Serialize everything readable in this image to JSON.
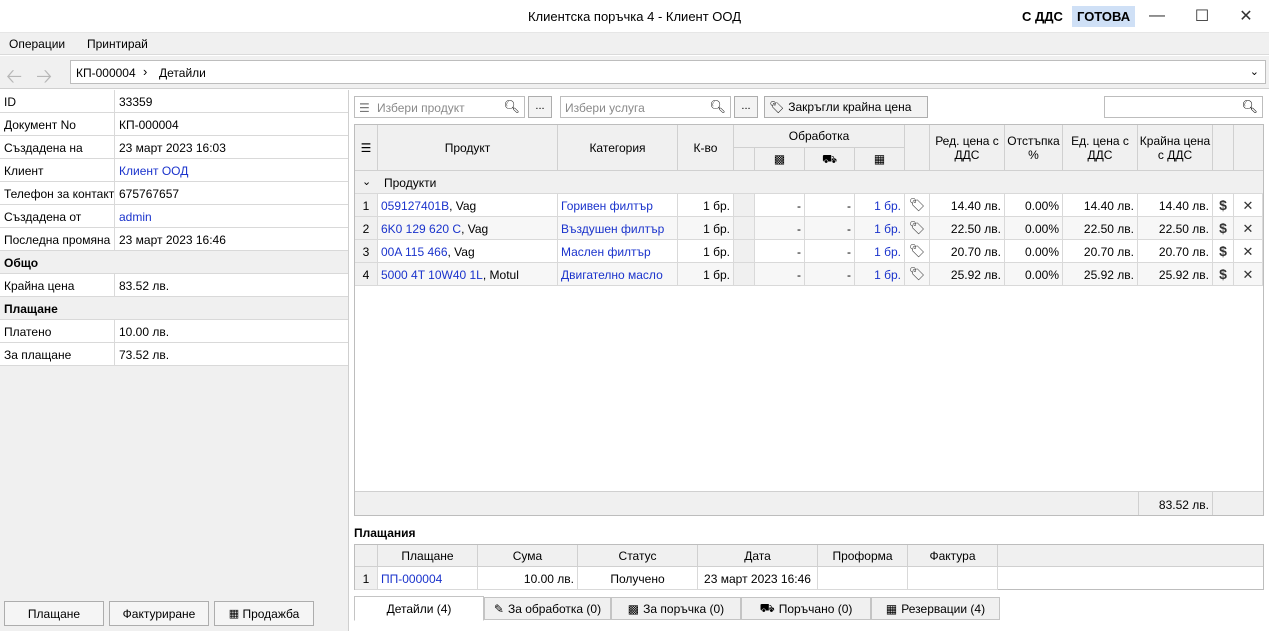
{
  "window": {
    "title": "Клиентска поръчка 4 - Клиент ООД",
    "vat_label": "С ДДС",
    "status": "ГОТОВА"
  },
  "menu": [
    "Операции",
    "Принтирай"
  ],
  "breadcrumb": {
    "doc": "КП-000004",
    "section": "Детайли"
  },
  "details": [
    {
      "key": "ID",
      "value": "33359"
    },
    {
      "key": "Документ No",
      "value": "КП-000004"
    },
    {
      "key": "Създадена на",
      "value": "23 март 2023 16:03"
    },
    {
      "key": "Клиент",
      "value": "Клиент ООД",
      "link": true
    },
    {
      "key": "Телефон за контакт",
      "value": "675767657"
    },
    {
      "key": "Създадена от",
      "value": "admin",
      "link": true
    },
    {
      "key": "Последна промяна",
      "value": "23 март 2023 16:46"
    }
  ],
  "total_group": "Общо",
  "total_row": {
    "key": "Крайна цена",
    "value": "83.52 лв."
  },
  "payment_group": "Плащане",
  "payment_rows": [
    {
      "key": "Платено",
      "value": "10.00 лв."
    },
    {
      "key": "За плащане",
      "value": "73.52 лв."
    }
  ],
  "left_buttons": {
    "pay": "Плащане",
    "invoice": "Фактуриране",
    "sale": "Продажба"
  },
  "toolbar": {
    "product_placeholder": "Избери продукт",
    "service_placeholder": "Избери услуга",
    "dots": "...",
    "round_label": "Закръгли крайна цена"
  },
  "grid": {
    "headers": {
      "product": "Продукт",
      "category": "Категория",
      "qty": "К-во",
      "processing": "Обработка",
      "unit_price_vat": "Ред. цена с ДДС",
      "discount": "Отстъпка %",
      "unit_price": "Ед. цена с ДДС",
      "final_price": "Крайна цена с ДДС"
    },
    "group_label": "Продукти",
    "rows": [
      {
        "n": "1",
        "code": "059127401B",
        "brand": ", Vag",
        "category": "Горивен филтър",
        "qty": "1 бр.",
        "p1": "-",
        "p2": "-",
        "p3": "1 бр.",
        "price": "14.40 лв.",
        "disc": "0.00%",
        "unit": "14.40 лв.",
        "final": "14.40 лв."
      },
      {
        "n": "2",
        "code": "6K0 129 620 C",
        "brand": ", Vag",
        "category": "Въздушен филтър",
        "qty": "1 бр.",
        "p1": "-",
        "p2": "-",
        "p3": "1 бр.",
        "price": "22.50 лв.",
        "disc": "0.00%",
        "unit": "22.50 лв.",
        "final": "22.50 лв."
      },
      {
        "n": "3",
        "code": "00A 115 466",
        "brand": ", Vag",
        "category": "Маслен филтър",
        "qty": "1 бр.",
        "p1": "-",
        "p2": "-",
        "p3": "1 бр.",
        "price": "20.70 лв.",
        "disc": "0.00%",
        "unit": "20.70 лв.",
        "final": "20.70 лв."
      },
      {
        "n": "4",
        "code": "5000 4T 10W40 1L",
        "brand": ", Motul",
        "category": "Двигателно масло",
        "qty": "1 бр.",
        "p1": "-",
        "p2": "-",
        "p3": "1 бр.",
        "price": "25.92 лв.",
        "disc": "0.00%",
        "unit": "25.92 лв.",
        "final": "25.92 лв."
      }
    ],
    "footer_total": "83.52 лв."
  },
  "payments": {
    "title": "Плащания",
    "headers": {
      "payment": "Плащане",
      "amount": "Сума",
      "status": "Статус",
      "date": "Дата",
      "proforma": "Проформа",
      "invoice": "Фактура"
    },
    "rows": [
      {
        "n": "1",
        "payment": "ПП-000004",
        "amount": "10.00 лв.",
        "status": "Получено",
        "date": "23 март 2023 16:46",
        "proforma": "",
        "invoice": ""
      }
    ]
  },
  "tabs": [
    {
      "label": "Детайли (4)"
    },
    {
      "label": "За обработка (0)"
    },
    {
      "label": "За поръчка (0)"
    },
    {
      "label": "Поръчано (0)"
    },
    {
      "label": "Резервации (4)"
    }
  ]
}
